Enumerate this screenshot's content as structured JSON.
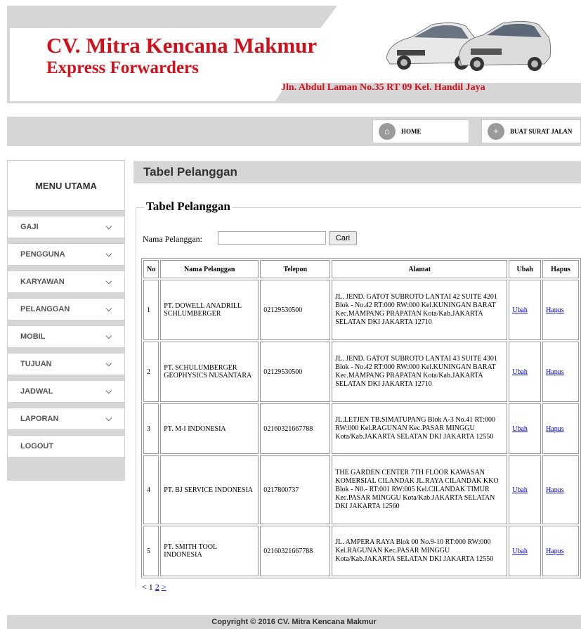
{
  "header": {
    "company": "CV. Mitra Kencana Makmur",
    "subtitle": "Express Forwarders",
    "address": "Jln. Abdul Laman No.35 RT 09 Kel. Handil Jaya"
  },
  "topnav": {
    "home_label": "HOME",
    "surat_label": "BUAT SURAT JALAN"
  },
  "sidebar": {
    "title": "MENU UTAMA",
    "items": [
      {
        "label": "GAJI"
      },
      {
        "label": "PENGGUNA"
      },
      {
        "label": "KARYAWAN"
      },
      {
        "label": "PELANGGAN"
      },
      {
        "label": "MOBIL"
      },
      {
        "label": "TUJUAN"
      },
      {
        "label": "JADWAL"
      },
      {
        "label": "LAPORAN"
      },
      {
        "label": "LOGOUT"
      }
    ]
  },
  "main": {
    "page_title": "Tabel Pelanggan",
    "legend": "Tabel Pelanggan",
    "search_label": "Nama Pelanggan:",
    "search_value": "",
    "search_button": "Cari",
    "columns": [
      "No",
      "Nama Pelanggan",
      "Telepon",
      "Alamat",
      "Ubah",
      "Hapus"
    ],
    "rows": [
      {
        "no": "1",
        "nama": "PT. DOWELL ANADRILL SCHLUMBERGER",
        "telepon": "02129530500",
        "alamat": "JL. JEND. GATOT SUBROTO LANTAI 42 SUITE 4201 Blok - No.42 RT:000 RW:000 Kel.KUNINGAN BARAT Kec.MAMPANG PRAPATAN Kota/Kab.JAKARTA SELATAN DKI JAKARTA 12710",
        "ubah": "Ubah",
        "hapus": "Hapus"
      },
      {
        "no": "2",
        "nama": "PT. SCHULUMBERGER GEOPHYSICS NUSANTARA",
        "telepon": "02129530500",
        "alamat": "JL. JEND. GATOT SUBROTO LANTAI 43 SUITE 4301 Blok - No.42 RT:000 RW:000 Kel.KUNINGAN BARAT Kec.MAMPANG PRAPATAN Kota/Kab.JAKARTA SELATAN DKI JAKARTA 12710",
        "ubah": "Ubah",
        "hapus": "Hapus"
      },
      {
        "no": "3",
        "nama": "PT. M-I INDONESIA",
        "telepon": "02160321667788",
        "alamat": "JL.LETJEN TB.SIMATUPANG Blok A-3 No.41 RT:000 RW:000 Kel.RAGUNAN Kec.PASAR MINGGU Kota/Kab.JAKARTA SELATAN DKI JAKARTA 12550",
        "ubah": "Ubah",
        "hapus": "Hapus"
      },
      {
        "no": "4",
        "nama": "PT. BJ SERVICE INDONESIA",
        "telepon": "0217800737",
        "alamat": "THE GARDEN CENTER 7TH FLOOR KAWASAN KOMERSIAL CILANDAK JL.RAYA CILANDAK KKO Blok - N0.- RT:001 RW:005 Kel.CILANDAK TIMUR Kec.PASAR MINGGU Kota/Kab.JAKARTA SELATAN DKI JAKARTA 12560",
        "ubah": "Ubah",
        "hapus": "Hapus"
      },
      {
        "no": "5",
        "nama": "PT. SMITH TOOL INDONESIA",
        "telepon": "02160321667788",
        "alamat": "JL. AMPERA RAYA Blok 00 No.9-10 RT:000 RW:000 Kel.RAGUNAN Kec.PASAR MINGGU Kota/Kab.JAKARTA SELATAN DKI JAKARTA 12550",
        "ubah": "Ubah",
        "hapus": "Hapus"
      }
    ],
    "pager": {
      "prev": "<",
      "current": "1",
      "next_page": "2",
      "next": ">"
    }
  },
  "footer": {
    "copyright": "Copyright © 2016 CV. Mitra Kencana Makmur"
  },
  "colors": {
    "brand_red": "#d0101a",
    "panel_gray": "#d6d6d6",
    "link_blue": "#0000ee"
  },
  "icons": {
    "home": "home-icon",
    "surat": "plus-icon",
    "menu_chevron": "chevron-down-icon"
  }
}
